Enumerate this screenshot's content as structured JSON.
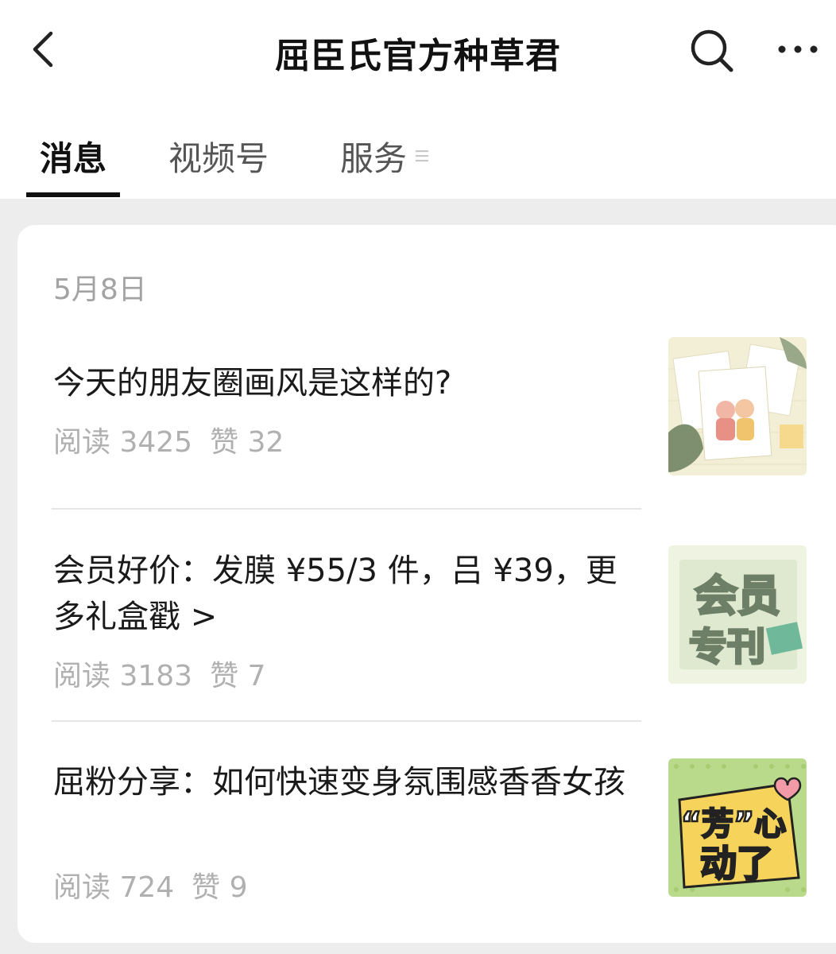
{
  "header": {
    "title": "屈臣氏官方种草君",
    "back_icon": "back-chevron-icon",
    "search_icon": "search-icon",
    "more_icon": "more-dots-icon"
  },
  "tabs": [
    {
      "label": "消息",
      "active": true
    },
    {
      "label": "视频号",
      "active": false
    },
    {
      "label": "服务",
      "active": false
    }
  ],
  "feed": {
    "date": "5月8日",
    "articles": [
      {
        "title": "今天的朋友圈画风是这样的?",
        "reads_label": "阅读 3425",
        "likes_label": "赞 32",
        "thumb_icon": "illustration-thumbnail"
      },
      {
        "title": "会员好价：发膜 ¥55/3 件，吕 ¥39，更多礼盒戳 >",
        "reads_label": "阅读 3183",
        "likes_label": "赞 7",
        "thumb_icon": "member-special-thumbnail",
        "thumb_text_1": "会员",
        "thumb_text_2": "专刊"
      },
      {
        "title": "屈粉分享：如何快速变身氛围感香香女孩",
        "reads_label": "阅读 724",
        "likes_label": "赞 9",
        "thumb_icon": "heart-flutter-thumbnail",
        "thumb_text_1": "“芳”心",
        "thumb_text_2": "动了"
      }
    ]
  },
  "colors": {
    "background": "#ededed",
    "card": "#ffffff",
    "meta_text": "#b0b0b0",
    "thumb_green": "#b9d98b"
  }
}
